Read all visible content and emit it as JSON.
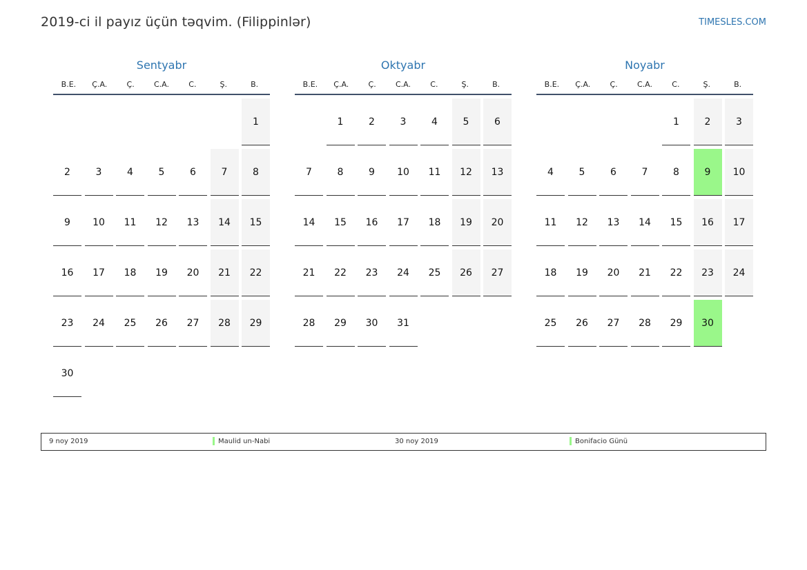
{
  "header": {
    "title": "2019-ci il payız üçün təqvim. (Filippinlər)",
    "site": "TIMESLES.COM"
  },
  "weekdays": [
    "B.E.",
    "Ç.A.",
    "Ç.",
    "C.A.",
    "C.",
    "Ş.",
    "B."
  ],
  "colors": {
    "accent": "#2e75b0",
    "weekend_bg": "#f4f4f4",
    "holiday_bg": "#9af78a"
  },
  "months": [
    {
      "name": "Sentyabr",
      "offset": 6,
      "days": 30,
      "holidays": []
    },
    {
      "name": "Oktyabr",
      "offset": 1,
      "days": 31,
      "holidays": []
    },
    {
      "name": "Noyabr",
      "offset": 4,
      "days": 30,
      "holidays": [
        9,
        30
      ]
    }
  ],
  "legend": [
    {
      "date": "9 noy 2019",
      "name": "Maulid un-Nabi"
    },
    {
      "date": "30 noy 2019",
      "name": "Bonifacio Günü"
    }
  ]
}
